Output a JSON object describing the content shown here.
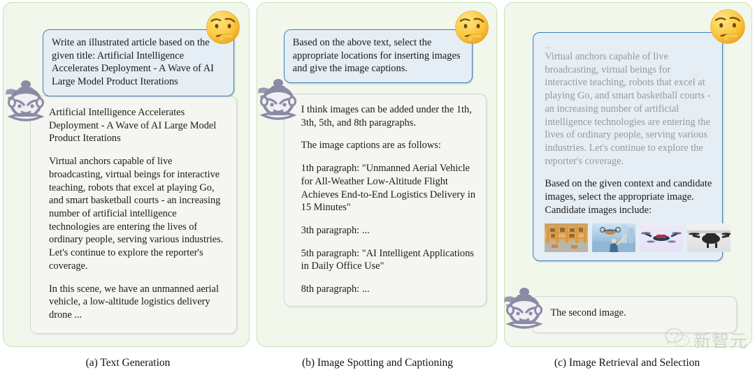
{
  "figure": {
    "panels": [
      {
        "id": "a",
        "caption": "(a) Text Generation",
        "emoji": "thinking-face-emoji",
        "avatar": "assistant-avatar-icon",
        "user_message": "Write an illustrated article based on the given title: Artificial Intelligence Accelerates Deployment - A Wave of AI Large Model Product Iterations",
        "bot_paragraphs": [
          "Artificial Intelligence Accelerates Deployment - A Wave of AI Large Model Product Iterations",
          "Virtual anchors capable of live broadcasting, virtual beings for interactive teaching, robots that excel at playing Go, and smart basketball courts - an increasing number of artificial intelligence technologies are entering the lives of ordinary people, serving various industries. Let's continue to explore the reporter's coverage.",
          "In this scene, we have an unmanned aerial vehicle, a low-altitude logistics delivery drone ..."
        ]
      },
      {
        "id": "b",
        "caption": "(b) Image Spotting and Captioning",
        "emoji": "thinking-face-emoji",
        "avatar": "assistant-avatar-icon",
        "user_message": "Based on the above text, select the appropriate locations for inserting images and give the image captions.",
        "bot_paragraphs": [
          "I think images can be added under the 1th, 3th, 5th, and 8th paragraphs.",
          "The image captions are as follows:",
          "1th paragraph: \"Unmanned Aerial Vehicle for All-Weather Low-Altitude Flight Achieves End-to-End Logistics Delivery in 15 Minutes\"",
          "3th paragraph: ...",
          "5th paragraph: \"AI Intelligent Applications in Daily Office Use\"",
          "8th paragraph: ..."
        ]
      },
      {
        "id": "c",
        "caption": "(c) Image Retrieval and Selection",
        "emoji": "thinking-face-emoji",
        "avatar": "assistant-avatar-icon",
        "user_context_ellipsis": "...",
        "user_context": "Virtual anchors capable of live broadcasting, virtual beings for interactive teaching, robots that excel at playing Go, and smart basketball courts - an increasing number of artificial intelligence technologies are entering the lives of ordinary people, serving various industries. Let's continue to explore the reporter's coverage.",
        "user_message": "Based on the given context and candidate images, select the appropriate image. Candidate images include:",
        "candidate_images": [
          {
            "name": "candidate-image-1",
            "alt": "warehouse shelves with logistics robot"
          },
          {
            "name": "candidate-image-2",
            "alt": "delivery drone flying with person below"
          },
          {
            "name": "candidate-image-3",
            "alt": "racing drone on light purple background"
          },
          {
            "name": "candidate-image-4",
            "alt": "dark drone on snowy white ground"
          }
        ],
        "bot_answer": "The second image."
      }
    ]
  },
  "watermark": {
    "icon": "wechat-icon",
    "text": "新智元"
  },
  "colors": {
    "panel_border": "#c6e0b4",
    "panel_fill": "#f2f7ec",
    "user_bubble_border": "#3b7fbf",
    "user_bubble_fill": "#e4eef4",
    "bot_bubble_border": "#d6d6d6",
    "bot_bubble_fill": "#f5f6f2",
    "faded_text": "#9a9a9a"
  }
}
